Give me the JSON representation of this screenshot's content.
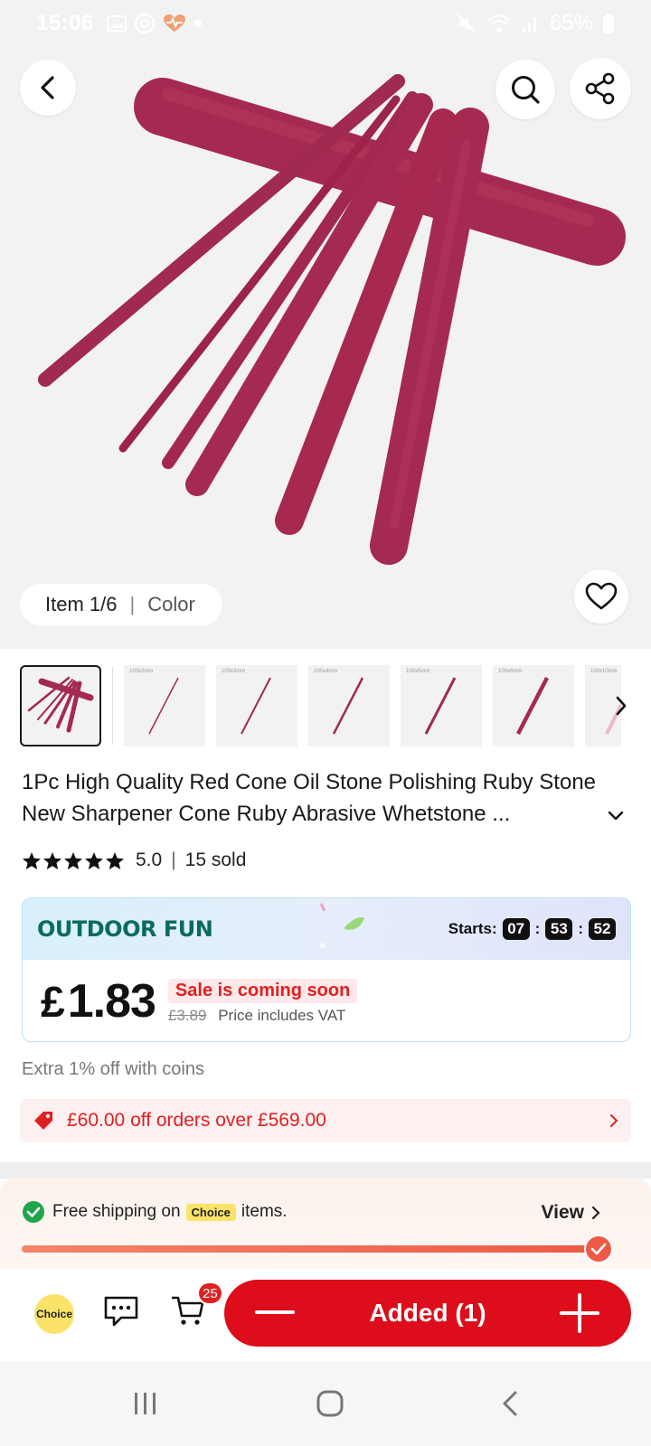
{
  "status_bar": {
    "time": "15:06",
    "battery": "65%"
  },
  "gallery": {
    "item_index": "Item 1/6",
    "variant_label": "Color",
    "thumb_labels": [
      "100x2mm",
      "100x3mm",
      "100x4mm",
      "100x5mm",
      "100x6mm",
      "100x10mm"
    ]
  },
  "product": {
    "title": "1Pc High Quality Red Cone Oil Stone Polishing Ruby Stone New Sharpener Cone Ruby Abrasive Whetstone ...",
    "rating": "5.0",
    "sold": "15 sold"
  },
  "promo": {
    "title": "OUTDOOR FUN",
    "starts_label": "Starts:",
    "timer": [
      "07",
      "53",
      "52"
    ],
    "currency": "£",
    "price": "1.83",
    "sale_badge": "Sale is coming soon",
    "old_price": "£3.89",
    "vat_note": "Price includes VAT"
  },
  "coins_note": "Extra 1% off with coins",
  "coupon": {
    "text": "£60.00 off orders over £569.00"
  },
  "shipping": {
    "prefix": "Free shipping on",
    "chip": "Choice",
    "suffix": "items.",
    "view_label": "View",
    "progress": 1.0
  },
  "actions": {
    "choice_label": "Choice",
    "cart_count": "25",
    "added_label": "Added (1)"
  },
  "colors": {
    "accent_red": "#dd0d1b",
    "promo_green": "#0b6b5e",
    "rod_color": "#a3284f",
    "choice_yellow": "#fbe36a"
  }
}
